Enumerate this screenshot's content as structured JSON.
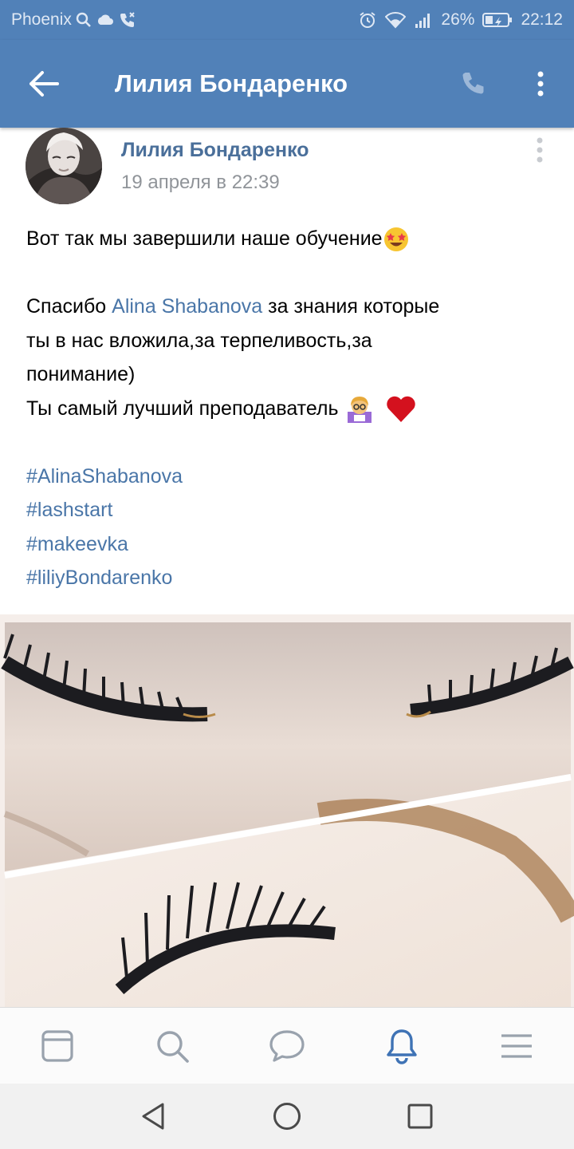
{
  "status_bar": {
    "carrier": "Phoenix",
    "battery": "26%",
    "time": "22:12"
  },
  "app_bar": {
    "title": "Лилия Бондаренко"
  },
  "post": {
    "author": "Лилия Бондаренко",
    "date": "19 апреля в 22:39",
    "line1": "Вот так мы завершили наше обучение",
    "line2_pre": "Спасибо ",
    "line2_link": "Alina Shabanova",
    "line2_post": " за знания которые",
    "line3": "ты в нас вложила,за терпеливость,за",
    "line4": "понимание)",
    "line5": "Ты самый лучший преподаватель ",
    "hashtags": [
      "#AlinaShabanova",
      "#lashstart",
      "#makeevka",
      "#liliyBondarenko"
    ]
  },
  "colors": {
    "brand": "#5181b8",
    "link": "#4a76a8",
    "active_nav": "#3f73b5"
  },
  "bottom_nav": {
    "items": [
      "news-icon",
      "search-icon",
      "messages-icon",
      "notifications-icon",
      "menu-icon"
    ],
    "active": "notifications-icon"
  }
}
